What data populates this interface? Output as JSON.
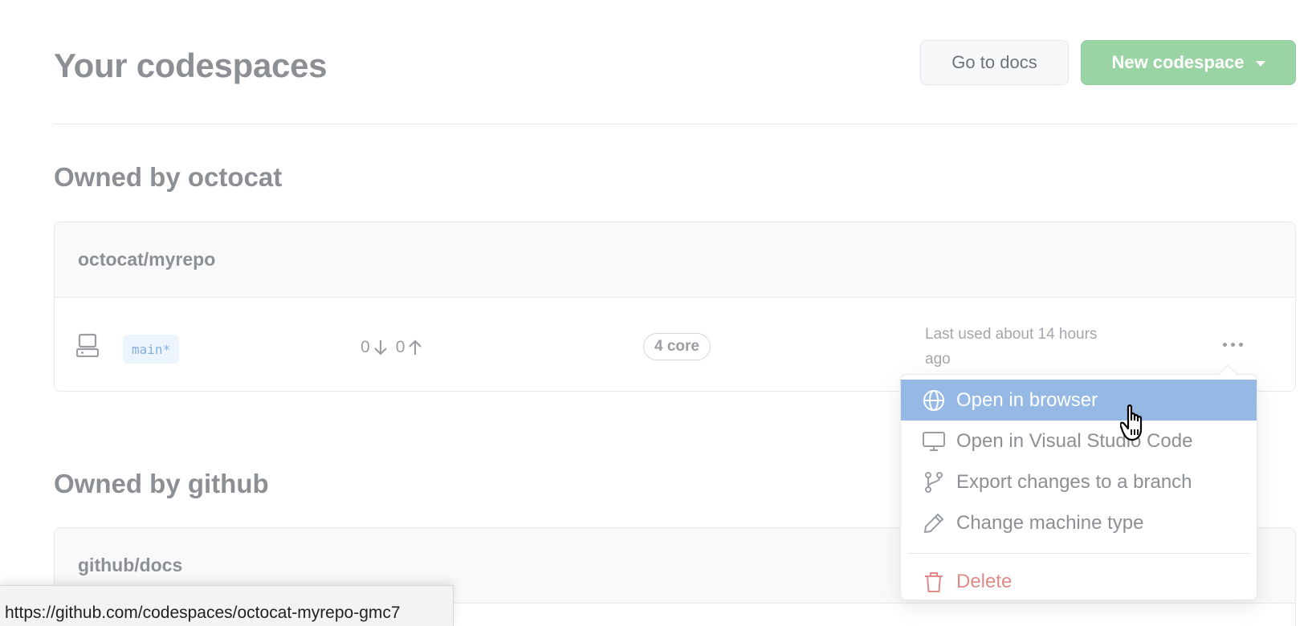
{
  "header": {
    "title": "Your codespaces",
    "docs_button": "Go to docs",
    "new_button": "New codespace"
  },
  "sections": [
    {
      "title": "Owned by octocat",
      "repo": "octocat/myrepo",
      "codespace": {
        "branch": "main*",
        "behind": "0",
        "ahead": "0",
        "cores": "4 core",
        "last_used": "Last used about 14 hours ago"
      }
    },
    {
      "title": "Owned by github",
      "repo": "github/docs"
    }
  ],
  "menu": {
    "items": [
      {
        "label": "Open in browser",
        "icon": "globe-icon",
        "active": true
      },
      {
        "label": "Open in Visual Studio Code",
        "icon": "desktop-icon"
      },
      {
        "label": "Export changes to a branch",
        "icon": "git-branch-icon"
      },
      {
        "label": "Change machine type",
        "icon": "pencil-icon"
      }
    ],
    "delete_label": "Delete"
  },
  "status_bar": {
    "url": "https://github.com/codespaces/octocat-myrepo-gmc7"
  },
  "colors": {
    "primary_green": "#9ad3a4",
    "menu_highlight": "#95b8e5",
    "danger": "#e08a86",
    "branch_tag_bg": "#ecf4fd"
  }
}
